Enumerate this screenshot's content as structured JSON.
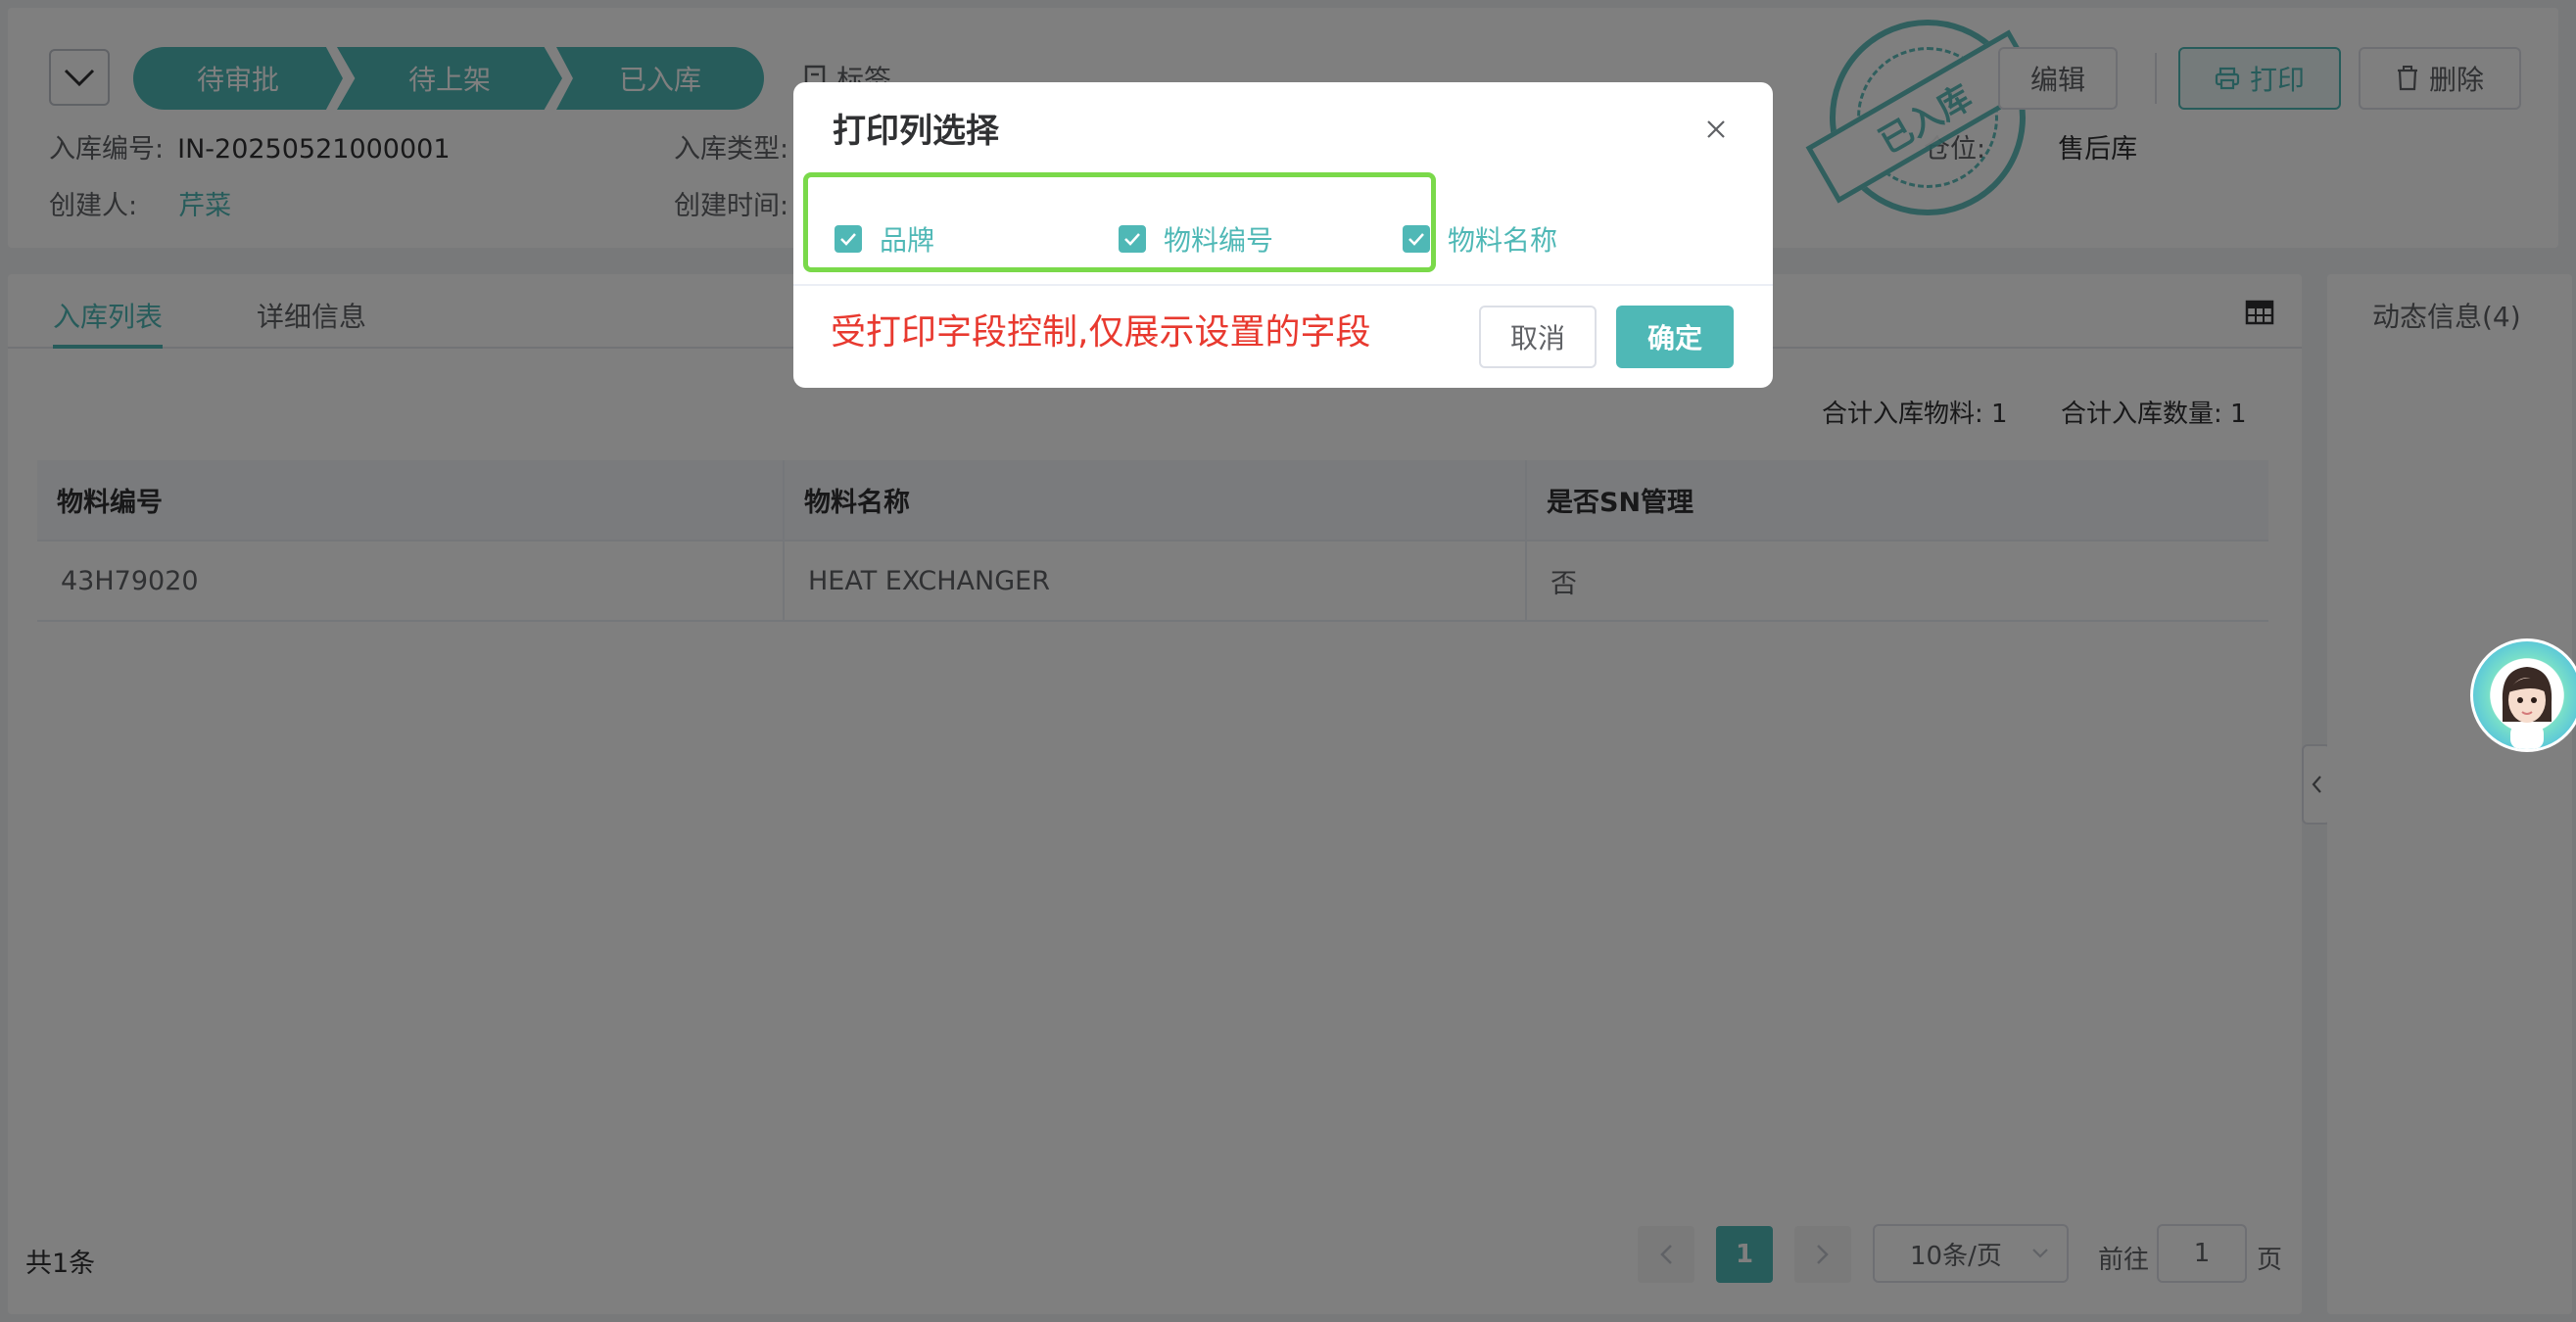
{
  "header": {
    "steps": [
      "待审批",
      "待上架",
      "已入库"
    ],
    "tag_label": "标签",
    "stamp_text": "已入库",
    "buttons": {
      "edit": "编辑",
      "print": "打印",
      "delete": "删除"
    },
    "fields": {
      "inbound_no_label": "入库编号:",
      "inbound_no": "IN-20250521000001",
      "inbound_type_label": "入库类型:",
      "creator_label": "创建人:",
      "creator": "芹菜",
      "created_time_label": "创建时间:",
      "warehouse_label": "仓位:",
      "warehouse": "售后库"
    }
  },
  "tabs": [
    "入库列表",
    "详细信息"
  ],
  "summary": {
    "total_materials": "合计入库物料: 1",
    "total_quantity": "合计入库数量: 1"
  },
  "table": {
    "columns": [
      "物料编号",
      "物料名称",
      "是否SN管理"
    ],
    "rows": [
      [
        "43H79020",
        "HEAT EXCHANGER",
        "否"
      ]
    ]
  },
  "pagination": {
    "total": "共1条",
    "current_page": "1",
    "page_size": "10条/页",
    "goto_label": "前往",
    "goto_value": "1",
    "page_suffix": "页"
  },
  "side": {
    "title": "动态信息(4)"
  },
  "dialog": {
    "title": "打印列选择",
    "options": [
      {
        "label": "品牌",
        "checked": true
      },
      {
        "label": "物料编号",
        "checked": true
      },
      {
        "label": "物料名称",
        "checked": true
      }
    ],
    "note": "受打印字段控制,仅展示设置的字段",
    "cancel": "取消",
    "confirm": "确定"
  },
  "colors": {
    "accent": "#4fb8b6",
    "highlight": "#7ad94a",
    "note": "#e8392f"
  }
}
